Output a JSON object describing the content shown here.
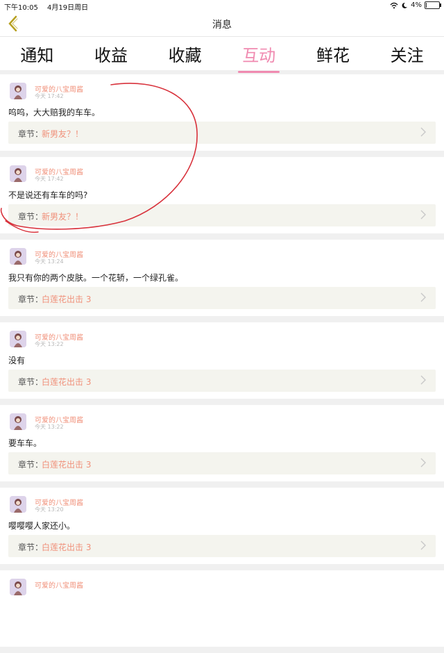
{
  "status_bar": {
    "time": "下午10:05",
    "date": "4月19日周日",
    "battery": "4%",
    "battery_level": 0.04
  },
  "nav": {
    "title": "消息",
    "back_icon": "chevron-left-icon"
  },
  "tabs": [
    {
      "label": "通知",
      "active": false
    },
    {
      "label": "收益",
      "active": false
    },
    {
      "label": "收藏",
      "active": false
    },
    {
      "label": "互动",
      "active": true
    },
    {
      "label": "鲜花",
      "active": false
    },
    {
      "label": "关注",
      "active": false
    }
  ],
  "chapter_label": "章节：",
  "messages": [
    {
      "user": "可爱的八宝周酱",
      "time": "今天 17:42",
      "text": "呜呜，大大赔我的车车。",
      "chapter": "新男友？！"
    },
    {
      "user": "可爱的八宝周酱",
      "time": "今天 17:42",
      "text": "不是说还有车车的吗?",
      "chapter": "新男友？！"
    },
    {
      "user": "可爱的八宝周酱",
      "time": "今天 13:24",
      "text": "我只有你的两个皮肤。一个花轿，一个绿孔雀。",
      "chapter": "白莲花出击 3"
    },
    {
      "user": "可爱的八宝周酱",
      "time": "今天 13:22",
      "text": "没有",
      "chapter": "白莲花出击 3"
    },
    {
      "user": "可爱的八宝周酱",
      "time": "今天 13:22",
      "text": "要车车。",
      "chapter": "白莲花出击 3"
    },
    {
      "user": "可爱的八宝周酱",
      "time": "今天 13:20",
      "text": "嘤嘤嘤人家还小。",
      "chapter": "白莲花出击 3"
    },
    {
      "user": "可爱的八宝周酱",
      "time": "",
      "text": "",
      "chapter": ""
    }
  ],
  "colors": {
    "accent": "#f08ab0",
    "username": "#f0907a",
    "annotation": "#d8323c"
  }
}
